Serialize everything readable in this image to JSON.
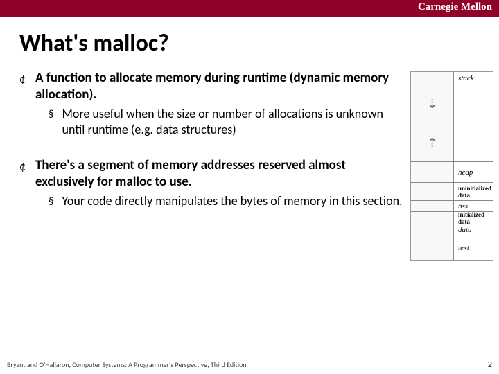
{
  "header": {
    "org": "Carnegie Mellon"
  },
  "title": "What's malloc?",
  "points": [
    {
      "main": "A function to allocate memory during runtime (dynamic memory allocation).",
      "sub": "More useful when the size or number of allocations is unknown until runtime (e.g. data structures)"
    },
    {
      "main": "There's a segment of memory addresses reserved almost exclusively for malloc to use.",
      "sub": "Your code directly manipulates the bytes of memory in this section."
    }
  ],
  "diagram": {
    "stack": "stack",
    "heap": "heap",
    "uninit": "uninitialized data",
    "bss": "bss",
    "init": "initialized data",
    "data": "data",
    "text": "text"
  },
  "footer": {
    "credit": "Bryant and O'Hallaron, Computer Systems: A Programmer's Perspective, Third Edition",
    "page": "2"
  }
}
